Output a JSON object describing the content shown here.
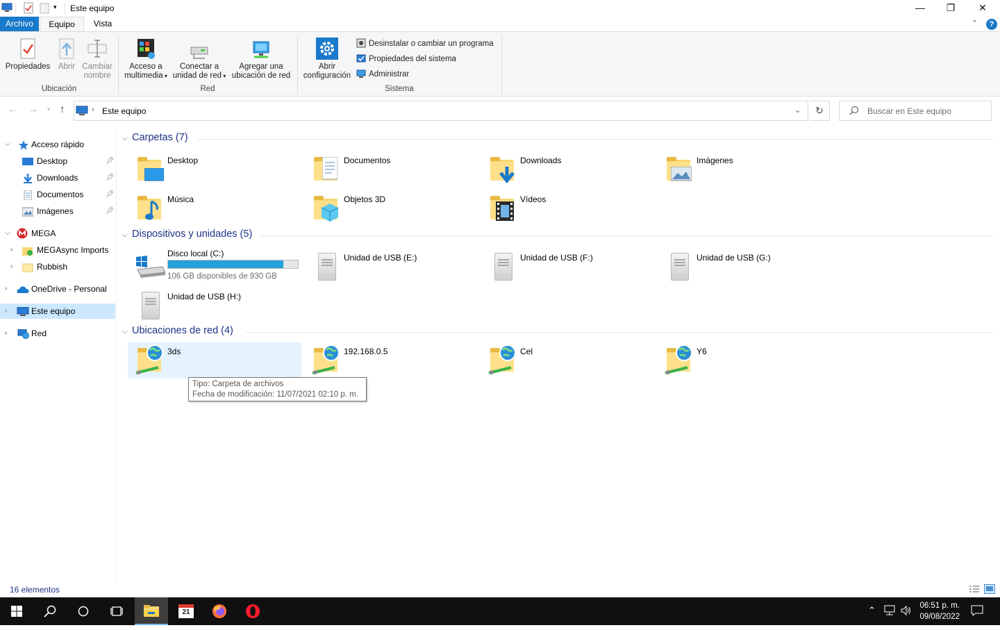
{
  "window": {
    "title": "Este equipo",
    "minimize": "—",
    "restore": "❐",
    "close": "✕"
  },
  "ribbon_tabs": [
    "Archivo",
    "Equipo",
    "Vista"
  ],
  "ribbon": {
    "ubicacion": {
      "label": "Ubicación",
      "propiedades": "Propiedades",
      "abrir": "Abrir",
      "cambiar_nombre_1": "Cambiar",
      "cambiar_nombre_2": "nombre"
    },
    "red": {
      "label": "Red",
      "acceso_1": "Acceso a",
      "acceso_2": "multimedia",
      "conectar_1": "Conectar a",
      "conectar_2": "unidad de red",
      "agregar_1": "Agregar una",
      "agregar_2": "ubicación de red"
    },
    "sistema": {
      "label": "Sistema",
      "abrir_1": "Abrir",
      "abrir_2": "configuración",
      "desinstalar": "Desinstalar o cambiar un programa",
      "propiedades_sistema": "Propiedades del sistema",
      "administrar": "Administrar"
    }
  },
  "address": {
    "path": "Este equipo",
    "search_placeholder": "Buscar en Este equipo"
  },
  "sidebar": {
    "quick_access": "Acceso rápido",
    "quick_items": [
      "Desktop",
      "Downloads",
      "Documentos",
      "Imágenes"
    ],
    "mega": "MEGA",
    "mega_items": [
      "MEGAsync Imports",
      "Rubbish"
    ],
    "onedrive": "OneDrive - Personal",
    "this_pc": "Este equipo",
    "network": "Red"
  },
  "sections": {
    "folders": "Carpetas (7)",
    "devices": "Dispositivos y unidades (5)",
    "network": "Ubicaciones de red (4)"
  },
  "folders": [
    "Desktop",
    "Documentos",
    "Downloads",
    "Imágenes",
    "Música",
    "Objetos 3D",
    "Vídeos"
  ],
  "drives": {
    "c_name": "Disco local (C:)",
    "c_free": "106 GB disponibles de 930 GB",
    "c_used_fraction": 0.886,
    "usb": [
      "Unidad de USB (E:)",
      "Unidad de USB (F:)",
      "Unidad de USB (G:)",
      "Unidad de USB (H:)"
    ]
  },
  "network_locations": [
    "3ds",
    "192.168.0.5",
    "Cel",
    "Y6"
  ],
  "tooltip": {
    "line1": "Tipo: Carpeta de archivos",
    "line2": "Fecha de modificación: 11/07/2021 02:10 p. m."
  },
  "status": {
    "count": "16 elementos"
  },
  "taskbar": {
    "time": "06:51 p. m.",
    "date": "09/08/2022",
    "calendar_day": "21"
  },
  "colors": {
    "accent": "#1979ca",
    "selection": "#cce8ff",
    "section_header": "#1e3287",
    "drive_fill": "#26a0da"
  }
}
